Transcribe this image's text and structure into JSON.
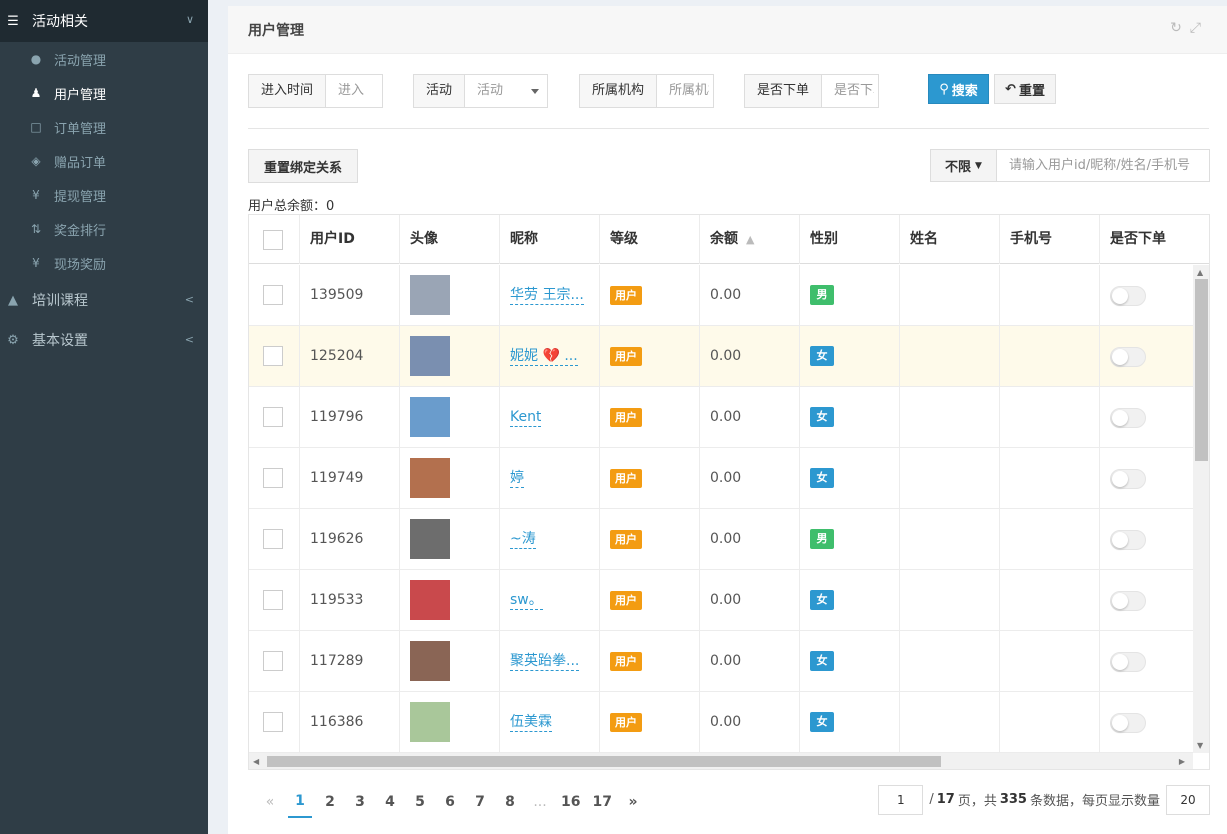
{
  "sidebar": {
    "groups": [
      {
        "label": "活动相关",
        "icon": "menu-icon",
        "expanded": true,
        "items": [
          {
            "label": "活动管理",
            "icon": "circle-icon",
            "active": false
          },
          {
            "label": "用户管理",
            "icon": "user-icon",
            "active": true
          },
          {
            "label": "订单管理",
            "icon": "file-icon",
            "active": false
          },
          {
            "label": "赠品订单",
            "icon": "diamond-icon",
            "active": false
          },
          {
            "label": "提现管理",
            "icon": "yen-icon",
            "active": false
          },
          {
            "label": "奖金排行",
            "icon": "sort-icon",
            "active": false
          },
          {
            "label": "现场奖励",
            "icon": "yen-icon",
            "active": false
          }
        ]
      },
      {
        "label": "培训课程",
        "icon": "graduation-cap-icon",
        "expanded": false
      },
      {
        "label": "基本设置",
        "icon": "gear-icon",
        "expanded": false
      }
    ]
  },
  "panel": {
    "title": "用户管理"
  },
  "filters": {
    "entry_time": {
      "label": "进入时间",
      "placeholder": "进入"
    },
    "activity": {
      "label": "活动",
      "placeholder": "活动"
    },
    "org": {
      "label": "所属机构",
      "placeholder": "所属机构"
    },
    "ordered": {
      "label": "是否下单",
      "placeholder": "是否下单"
    },
    "search_btn": "搜索",
    "reset_btn": "重置"
  },
  "toolbar": {
    "rebind_btn": "重置绑定关系",
    "scope_dropdown": "不限",
    "search_placeholder": "请输入用户id/昵称/姓名/手机号"
  },
  "total_balance": "用户总余额：0",
  "table": {
    "columns": [
      "",
      "用户ID",
      "头像",
      "昵称",
      "等级",
      "余额",
      "性别",
      "姓名",
      "手机号",
      "是否下单"
    ],
    "rows": [
      {
        "id": "139509",
        "nickname": "华劳 王宗...",
        "level": "用户",
        "balance": "0.00",
        "gender": "男",
        "name": "",
        "phone": "",
        "highlight": false,
        "avatar": "#9aa5b5"
      },
      {
        "id": "125204",
        "nickname": "妮妮 💔 ...",
        "level": "用户",
        "balance": "0.00",
        "gender": "女",
        "name": "",
        "phone": "",
        "highlight": true,
        "avatar": "#7a8fb0"
      },
      {
        "id": "119796",
        "nickname": "Kent",
        "level": "用户",
        "balance": "0.00",
        "gender": "女",
        "name": "",
        "phone": "",
        "highlight": false,
        "avatar": "#6a9ccc"
      },
      {
        "id": "119749",
        "nickname": "婷",
        "level": "用户",
        "balance": "0.00",
        "gender": "女",
        "name": "",
        "phone": "",
        "highlight": false,
        "avatar": "#b3704e"
      },
      {
        "id": "119626",
        "nickname": "~涛",
        "level": "用户",
        "balance": "0.00",
        "gender": "男",
        "name": "",
        "phone": "",
        "highlight": false,
        "avatar": "#6d6d6d"
      },
      {
        "id": "119533",
        "nickname": "sw。",
        "level": "用户",
        "balance": "0.00",
        "gender": "女",
        "name": "",
        "phone": "",
        "highlight": false,
        "avatar": "#c9494c"
      },
      {
        "id": "117289",
        "nickname": "聚英跆拳...",
        "level": "用户",
        "balance": "0.00",
        "gender": "女",
        "name": "",
        "phone": "",
        "highlight": false,
        "avatar": "#8a6555"
      },
      {
        "id": "116386",
        "nickname": "伍美霖",
        "level": "用户",
        "balance": "0.00",
        "gender": "女",
        "name": "",
        "phone": "",
        "highlight": false,
        "avatar": "#a9c79a"
      }
    ]
  },
  "pagination": {
    "prev": "«",
    "pages": [
      "1",
      "2",
      "3",
      "4",
      "5",
      "6",
      "7",
      "8",
      "...",
      "16",
      "17"
    ],
    "current": "1",
    "next": "»",
    "jump_value": "1",
    "info_prefix": "/",
    "total_pages": "17",
    "info_mid": "页，共",
    "total_records": "335",
    "info_suffix": "条数据，每页显示数量",
    "page_size": "20"
  },
  "colors": {
    "sidebar_bg": "#2f3d46",
    "accent": "#2c98d0",
    "user_badge": "#f39c12",
    "male": "#3fbe6c",
    "female": "#2c98d0"
  }
}
